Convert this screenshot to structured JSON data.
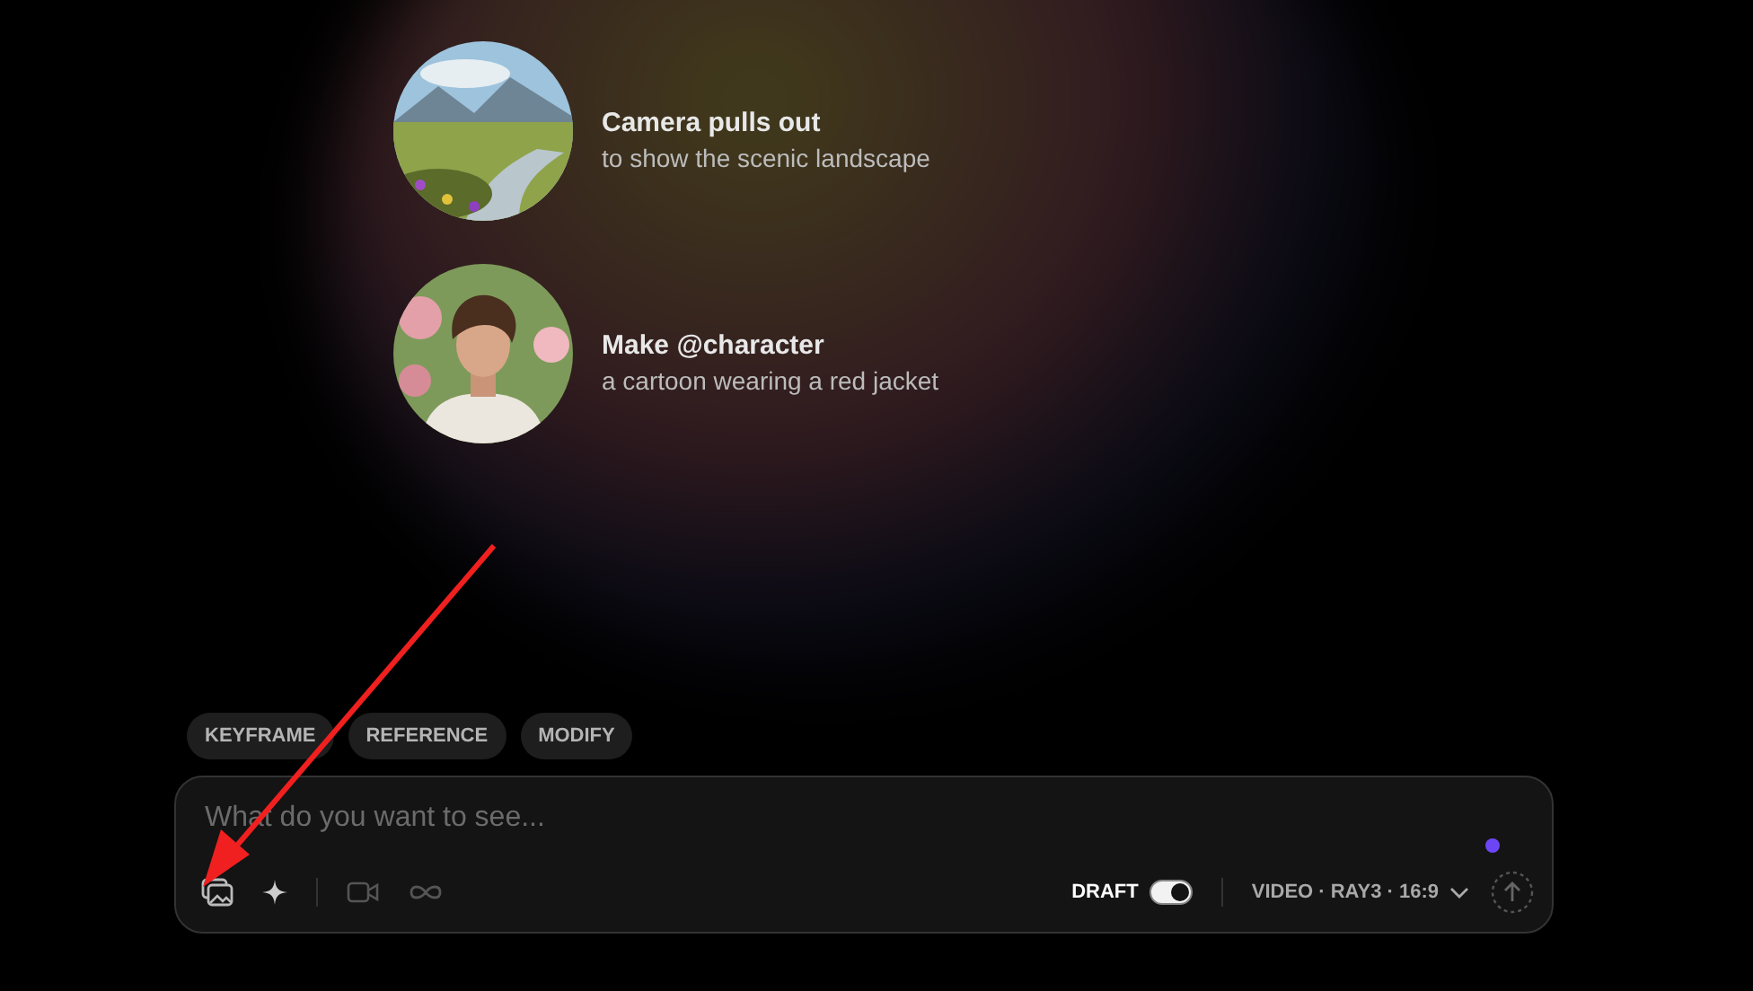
{
  "suggestions": [
    {
      "kind": "picture",
      "title": "Camera pulls out",
      "subtitle": "to show the scenic landscape"
    },
    {
      "kind": "picture",
      "title": "Make @character",
      "subtitle": "a cartoon wearing a red jacket"
    }
  ],
  "modes": [
    "KEYFRAME",
    "REFERENCE",
    "MODIFY"
  ],
  "prompt": {
    "placeholder": "What do you want to see..."
  },
  "draft": {
    "label": "DRAFT",
    "on": true
  },
  "settings": {
    "label": "VIDEO · RAY3 · 16:9"
  }
}
